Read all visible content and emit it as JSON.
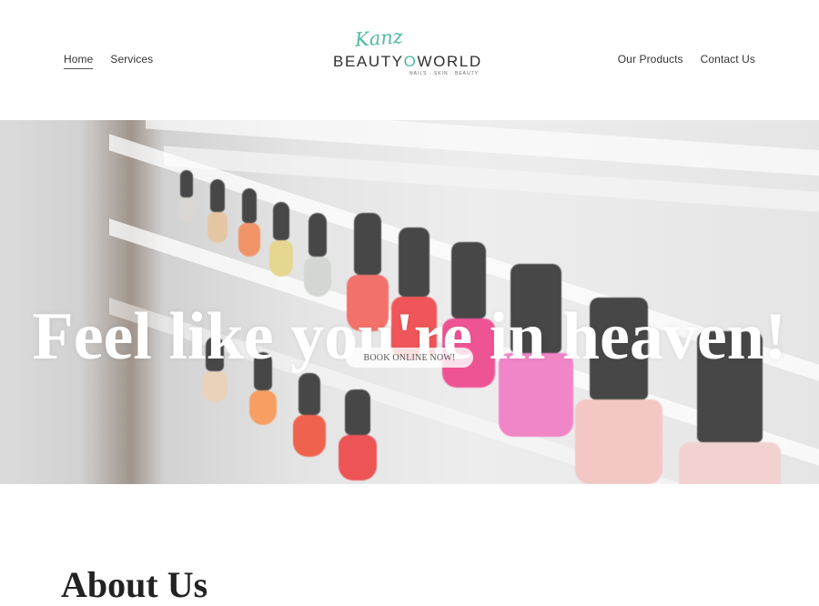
{
  "brand": {
    "script_text": "Kanz",
    "main_text": "BEAUTY",
    "main_o": "O",
    "main_suffix": "WORLD",
    "tagline": "NAILS · SKIN · BEAUTY"
  },
  "nav": {
    "left": [
      {
        "label": "Home",
        "active": true
      },
      {
        "label": "Services"
      }
    ],
    "right": [
      {
        "label": "Our Products"
      },
      {
        "label": "Contact Us"
      }
    ]
  },
  "hero": {
    "title": "Feel like you're in heaven!",
    "cta_label": "BOOK ONLINE NOW!"
  },
  "about": {
    "title": "About Us"
  },
  "colors": {
    "accent": "#4fb9a3",
    "text": "#333333",
    "hero_text": "#ffffff"
  }
}
